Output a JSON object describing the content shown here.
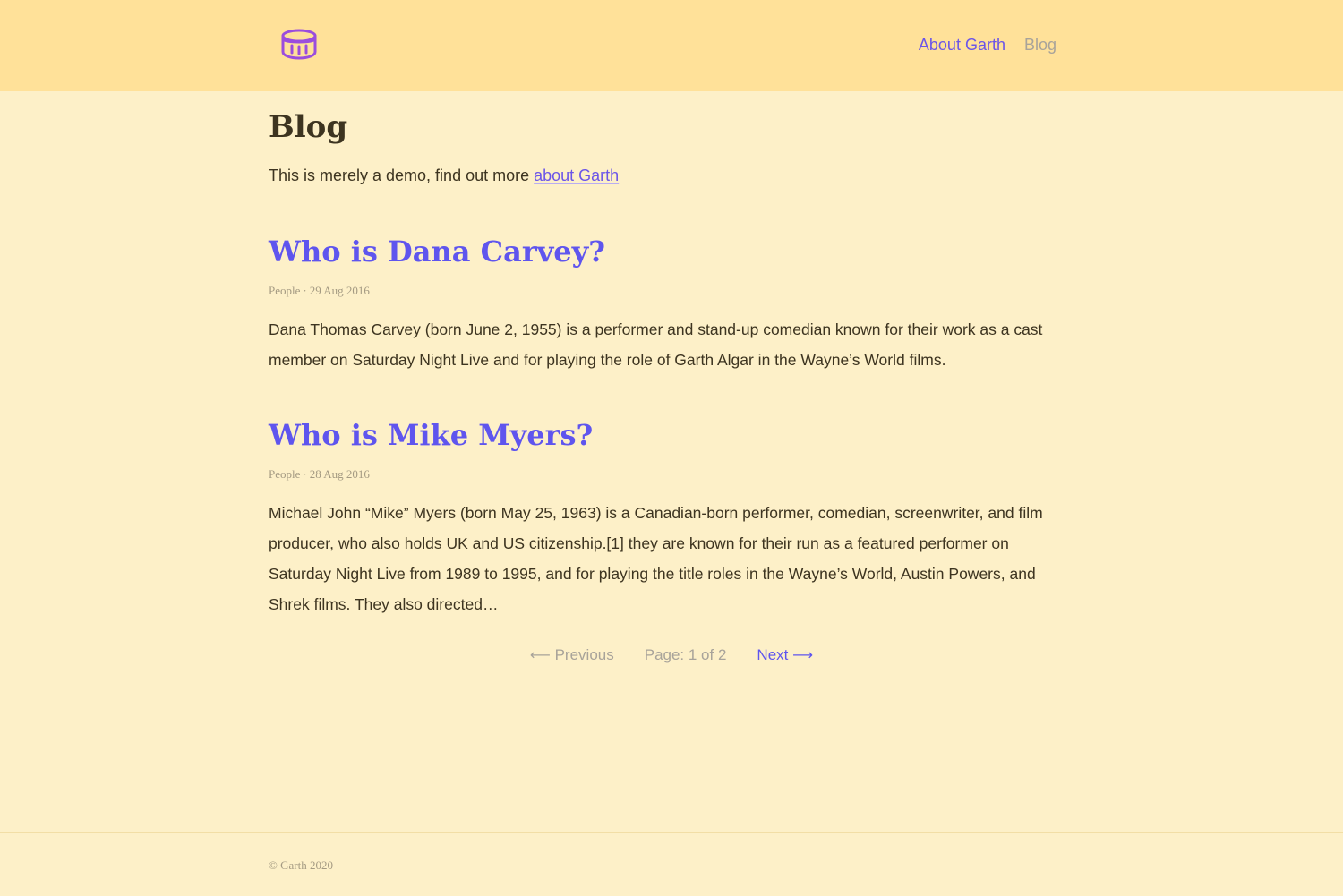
{
  "header": {
    "logo_icon": "drum-icon",
    "nav": {
      "about_label": "About Garth",
      "blog_label": "Blog"
    }
  },
  "main": {
    "title": "Blog",
    "intro_text": "This is merely a demo, find out more ",
    "intro_link": "about Garth"
  },
  "posts": [
    {
      "title": "Who is Dana Carvey?",
      "category": "People",
      "separator": "·",
      "date": "29 Aug 2016",
      "excerpt": "Dana Thomas Carvey (born June 2, 1955) is a performer and stand-up comedian known for their work as a cast member on Saturday Night Live and for playing the role of Garth Algar in the Wayne’s World films."
    },
    {
      "title": "Who is Mike Myers?",
      "category": "People",
      "separator": "·",
      "date": "28 Aug 2016",
      "excerpt": "Michael John “Mike” Myers (born May 25, 1963) is a Canadian-born performer, comedian, screenwriter, and film producer, who also holds UK and US citizenship.[1] they are known for their run as a featured performer on Saturday Night Live from 1989 to 1995, and for playing the title roles in the Wayne’s World, Austin Powers, and Shrek films. They also directed…"
    }
  ],
  "pagination": {
    "prev_arrow": "⟵",
    "prev_label": "Previous",
    "page_info": "Page: 1 of 2",
    "next_label": "Next",
    "next_arrow": "⟶"
  },
  "footer": {
    "copyright": "© Garth 2020"
  },
  "colors": {
    "header_bg": "#ffe199",
    "page_bg": "#fdf0c8",
    "accent": "#5f55ee",
    "logo": "#9b4ddd",
    "muted": "#a8a39a",
    "text": "#3d3420"
  }
}
